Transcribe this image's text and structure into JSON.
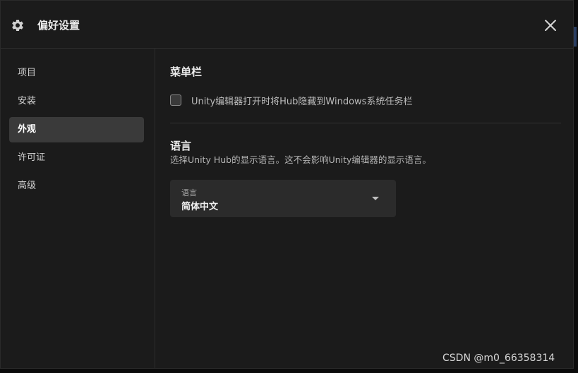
{
  "header": {
    "title": "偏好设置"
  },
  "sidebar": {
    "items": [
      {
        "label": "项目",
        "active": false
      },
      {
        "label": "安装",
        "active": false
      },
      {
        "label": "外观",
        "active": true
      },
      {
        "label": "许可证",
        "active": false
      },
      {
        "label": "高级",
        "active": false
      }
    ]
  },
  "main": {
    "menubar_section": {
      "title": "菜单栏",
      "checkbox_label": "Unity编辑器打开时将Hub隐藏到Windows系统任务栏",
      "checked": false
    },
    "language_section": {
      "title": "语言",
      "description": "选择Unity Hub的显示语言。这不会影响Unity编辑器的显示语言。",
      "select_label": "语言",
      "select_value": "简体中文"
    }
  },
  "watermark": "CSDN @m0_66358314",
  "colors": {
    "background": "#1b1b1b",
    "active_item": "#3a3a3a",
    "select_bg": "#2b2b2b"
  }
}
